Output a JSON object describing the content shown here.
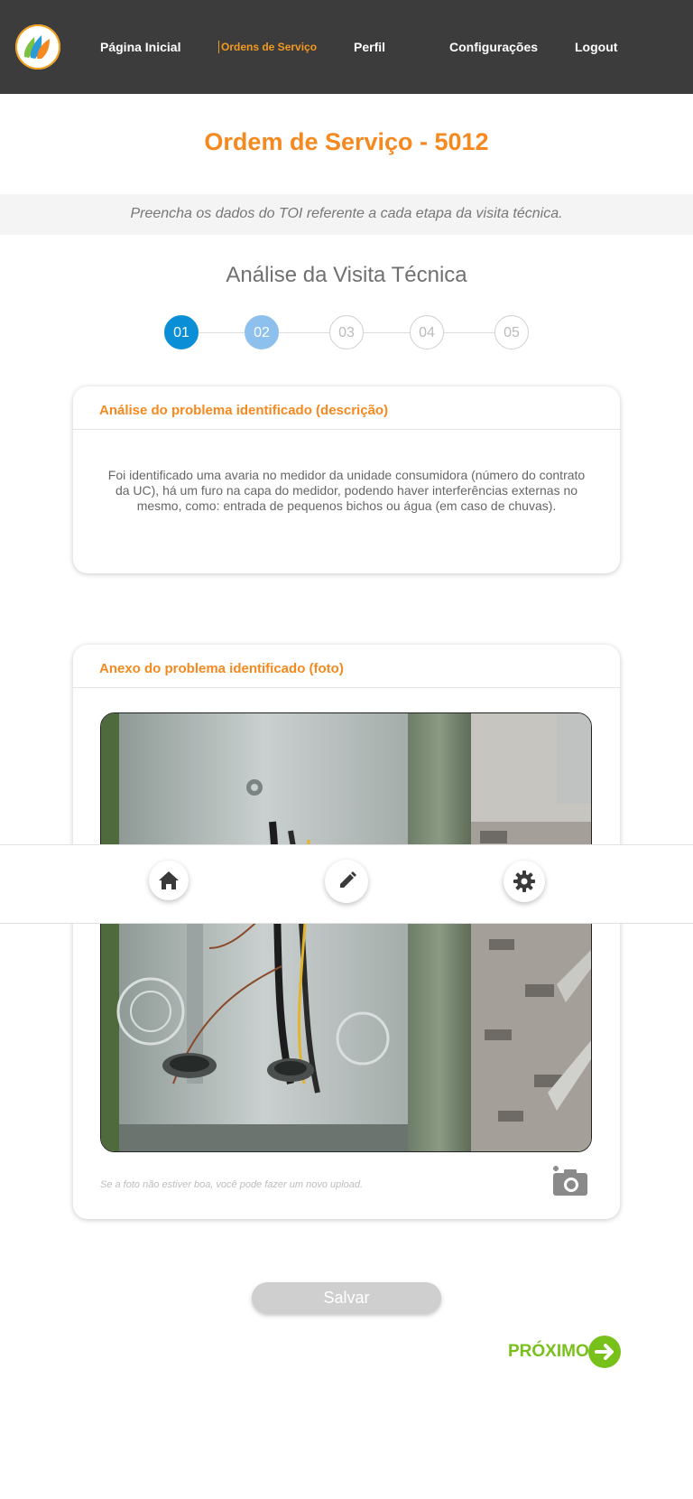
{
  "nav": {
    "items": [
      {
        "label": "Página Inicial"
      },
      {
        "label": "Ordens de Serviço"
      },
      {
        "label": "Perfil"
      },
      {
        "label": "Configurações"
      },
      {
        "label": "Logout"
      }
    ],
    "active_index": 1
  },
  "page": {
    "title": "Ordem de Serviço - 5012",
    "subtitle": "Preencha os dados do TOI referente a cada etapa da visita técnica.",
    "section_title": "Análise da Visita Técnica"
  },
  "steps": [
    "01",
    "02",
    "03",
    "04",
    "05"
  ],
  "current_step": 1,
  "description_card": {
    "title": "Análise do problema identificado (descrição)",
    "text": "Foi identificado uma avaria no medidor da unidade consumidora (número do contrato da UC), há um furo na capa do medidor, podendo haver interferências externas no mesmo, como: entrada de pequenos bichos ou água (em caso de chuvas)."
  },
  "photo_card": {
    "title": "Anexo do problema identificado (foto)",
    "hint": "Se a foto não estiver boa, você pode fazer um novo upload.",
    "upload_icon": "add-camera-icon"
  },
  "toolbar": {
    "icons": [
      "home-icon",
      "pencil-icon",
      "gear-icon"
    ]
  },
  "actions": {
    "save_label": "Salvar",
    "next_label": "PRÓXIMO"
  },
  "colors": {
    "topbar": "#3c3c3c",
    "accent_orange": "#f5891f",
    "step_active": "#0a8fd6",
    "step_visited": "#8ec0ee",
    "next_green": "#78c11b",
    "save_disabled": "#cfcfcf"
  }
}
